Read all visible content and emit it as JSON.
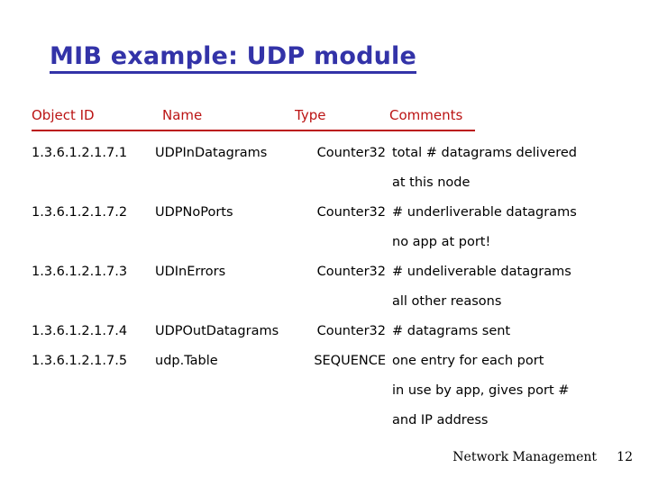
{
  "slide": {
    "title": "MIB example: UDP module",
    "title_color": "#3333a8",
    "header_color": "#bb1414",
    "body_color": "#000000",
    "background": "#ffffff"
  },
  "table": {
    "headers": {
      "object_id": "Object ID",
      "name": "Name",
      "type": "Type",
      "comments": "Comments"
    },
    "rows": [
      {
        "object_id": "1.3.6.1.2.1.7.1",
        "name": "UDPInDatagrams",
        "type": "Counter32",
        "comments": "total # datagrams delivered",
        "comments_cont": "at this node"
      },
      {
        "object_id": "1.3.6.1.2.1.7.2",
        "name": "UDPNoPorts",
        "type": "Counter32",
        "comments": "# underliverable datagrams",
        "comments_cont": "no app at port!"
      },
      {
        "object_id": "1.3.6.1.2.1.7.3",
        "name": "UDInErrors",
        "type": "Counter32",
        "comments": "# undeliverable datagrams",
        "comments_cont": "all other reasons"
      },
      {
        "object_id": "1.3.6.1.2.1.7.4",
        "name": "UDPOutDatagrams",
        "type": "Counter32",
        "comments": "# datagrams sent",
        "comments_cont": ""
      },
      {
        "object_id": "1.3.6.1.2.1.7.5",
        "name": "udp.Table",
        "type": "SEQUENCE",
        "comments": "one entry for each port",
        "comments_cont": "in use by app, gives port #",
        "comments_cont2": "and IP address"
      }
    ]
  },
  "footer": {
    "text": "Network Management",
    "page_number": "12"
  }
}
